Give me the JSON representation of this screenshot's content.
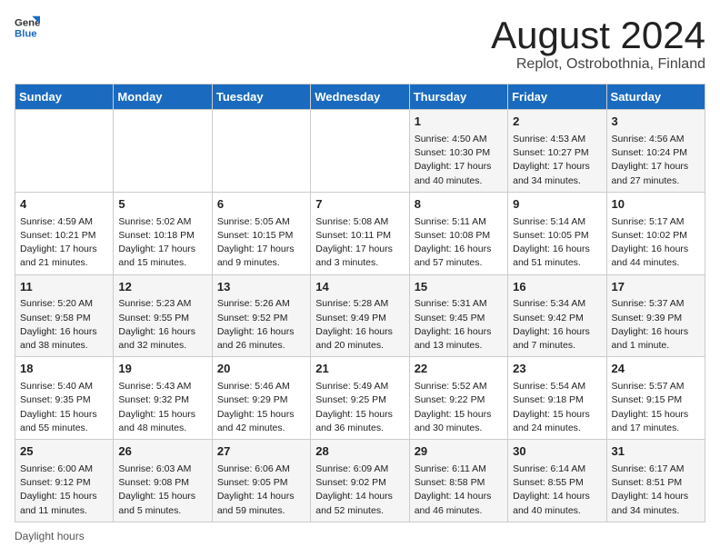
{
  "header": {
    "logo_general": "General",
    "logo_blue": "Blue",
    "main_title": "August 2024",
    "sub_title": "Replot, Ostrobothnia, Finland"
  },
  "days_of_week": [
    "Sunday",
    "Monday",
    "Tuesday",
    "Wednesday",
    "Thursday",
    "Friday",
    "Saturday"
  ],
  "weeks": [
    [
      {
        "day": "",
        "info": ""
      },
      {
        "day": "",
        "info": ""
      },
      {
        "day": "",
        "info": ""
      },
      {
        "day": "",
        "info": ""
      },
      {
        "day": "1",
        "info": "Sunrise: 4:50 AM\nSunset: 10:30 PM\nDaylight: 17 hours and 40 minutes."
      },
      {
        "day": "2",
        "info": "Sunrise: 4:53 AM\nSunset: 10:27 PM\nDaylight: 17 hours and 34 minutes."
      },
      {
        "day": "3",
        "info": "Sunrise: 4:56 AM\nSunset: 10:24 PM\nDaylight: 17 hours and 27 minutes."
      }
    ],
    [
      {
        "day": "4",
        "info": "Sunrise: 4:59 AM\nSunset: 10:21 PM\nDaylight: 17 hours and 21 minutes."
      },
      {
        "day": "5",
        "info": "Sunrise: 5:02 AM\nSunset: 10:18 PM\nDaylight: 17 hours and 15 minutes."
      },
      {
        "day": "6",
        "info": "Sunrise: 5:05 AM\nSunset: 10:15 PM\nDaylight: 17 hours and 9 minutes."
      },
      {
        "day": "7",
        "info": "Sunrise: 5:08 AM\nSunset: 10:11 PM\nDaylight: 17 hours and 3 minutes."
      },
      {
        "day": "8",
        "info": "Sunrise: 5:11 AM\nSunset: 10:08 PM\nDaylight: 16 hours and 57 minutes."
      },
      {
        "day": "9",
        "info": "Sunrise: 5:14 AM\nSunset: 10:05 PM\nDaylight: 16 hours and 51 minutes."
      },
      {
        "day": "10",
        "info": "Sunrise: 5:17 AM\nSunset: 10:02 PM\nDaylight: 16 hours and 44 minutes."
      }
    ],
    [
      {
        "day": "11",
        "info": "Sunrise: 5:20 AM\nSunset: 9:58 PM\nDaylight: 16 hours and 38 minutes."
      },
      {
        "day": "12",
        "info": "Sunrise: 5:23 AM\nSunset: 9:55 PM\nDaylight: 16 hours and 32 minutes."
      },
      {
        "day": "13",
        "info": "Sunrise: 5:26 AM\nSunset: 9:52 PM\nDaylight: 16 hours and 26 minutes."
      },
      {
        "day": "14",
        "info": "Sunrise: 5:28 AM\nSunset: 9:49 PM\nDaylight: 16 hours and 20 minutes."
      },
      {
        "day": "15",
        "info": "Sunrise: 5:31 AM\nSunset: 9:45 PM\nDaylight: 16 hours and 13 minutes."
      },
      {
        "day": "16",
        "info": "Sunrise: 5:34 AM\nSunset: 9:42 PM\nDaylight: 16 hours and 7 minutes."
      },
      {
        "day": "17",
        "info": "Sunrise: 5:37 AM\nSunset: 9:39 PM\nDaylight: 16 hours and 1 minute."
      }
    ],
    [
      {
        "day": "18",
        "info": "Sunrise: 5:40 AM\nSunset: 9:35 PM\nDaylight: 15 hours and 55 minutes."
      },
      {
        "day": "19",
        "info": "Sunrise: 5:43 AM\nSunset: 9:32 PM\nDaylight: 15 hours and 48 minutes."
      },
      {
        "day": "20",
        "info": "Sunrise: 5:46 AM\nSunset: 9:29 PM\nDaylight: 15 hours and 42 minutes."
      },
      {
        "day": "21",
        "info": "Sunrise: 5:49 AM\nSunset: 9:25 PM\nDaylight: 15 hours and 36 minutes."
      },
      {
        "day": "22",
        "info": "Sunrise: 5:52 AM\nSunset: 9:22 PM\nDaylight: 15 hours and 30 minutes."
      },
      {
        "day": "23",
        "info": "Sunrise: 5:54 AM\nSunset: 9:18 PM\nDaylight: 15 hours and 24 minutes."
      },
      {
        "day": "24",
        "info": "Sunrise: 5:57 AM\nSunset: 9:15 PM\nDaylight: 15 hours and 17 minutes."
      }
    ],
    [
      {
        "day": "25",
        "info": "Sunrise: 6:00 AM\nSunset: 9:12 PM\nDaylight: 15 hours and 11 minutes."
      },
      {
        "day": "26",
        "info": "Sunrise: 6:03 AM\nSunset: 9:08 PM\nDaylight: 15 hours and 5 minutes."
      },
      {
        "day": "27",
        "info": "Sunrise: 6:06 AM\nSunset: 9:05 PM\nDaylight: 14 hours and 59 minutes."
      },
      {
        "day": "28",
        "info": "Sunrise: 6:09 AM\nSunset: 9:02 PM\nDaylight: 14 hours and 52 minutes."
      },
      {
        "day": "29",
        "info": "Sunrise: 6:11 AM\nSunset: 8:58 PM\nDaylight: 14 hours and 46 minutes."
      },
      {
        "day": "30",
        "info": "Sunrise: 6:14 AM\nSunset: 8:55 PM\nDaylight: 14 hours and 40 minutes."
      },
      {
        "day": "31",
        "info": "Sunrise: 6:17 AM\nSunset: 8:51 PM\nDaylight: 14 hours and 34 minutes."
      }
    ]
  ],
  "footer": {
    "note": "Daylight hours"
  }
}
